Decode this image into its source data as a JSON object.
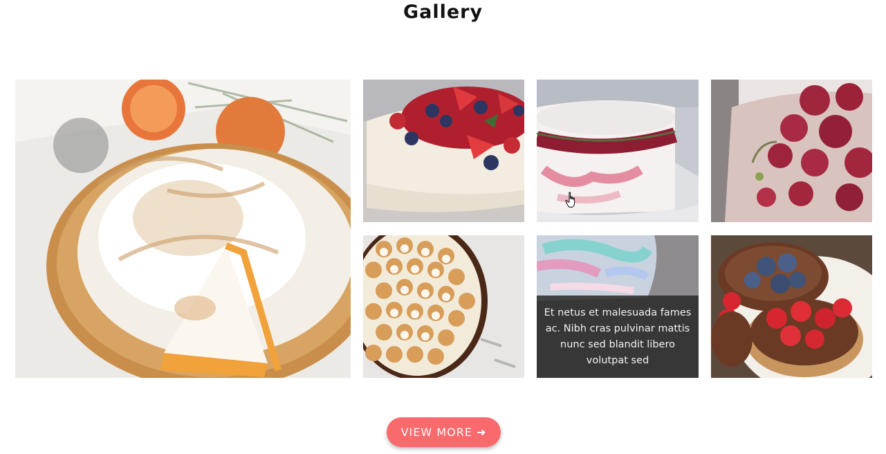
{
  "gallery": {
    "title": "Gallery",
    "tiles": [
      {
        "id": "meringue-tart"
      },
      {
        "id": "berry-cheesecake"
      },
      {
        "id": "cranberry-cake"
      },
      {
        "id": "raspberry-cake"
      },
      {
        "id": "marshmallow-pie"
      },
      {
        "id": "pastel-cake",
        "caption": "Et netus et malesuada fames ac. Nibh cras pulvinar mattis nunc sed blandit libero volutpat sed"
      },
      {
        "id": "chocolate-tarts"
      }
    ],
    "view_more_label": "VIEW MORE ➜"
  },
  "colors": {
    "accent": "#f86a6c",
    "caption_overlay": "#282828"
  },
  "icons": {
    "cursor": "hand-pointer-icon"
  }
}
